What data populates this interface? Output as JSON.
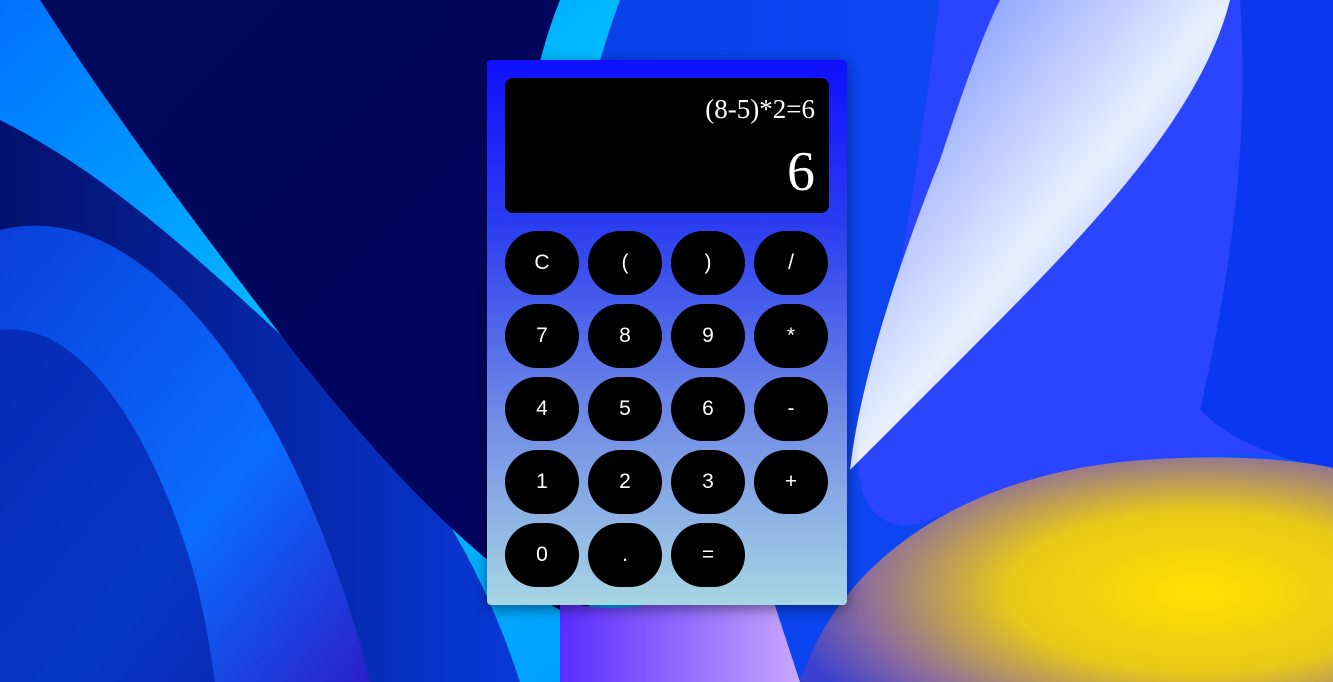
{
  "display": {
    "expression": "(8-5)*2=6",
    "result": "6"
  },
  "keypad": {
    "rows": [
      [
        {
          "label": "C",
          "name": "clear-button"
        },
        {
          "label": "(",
          "name": "open-paren-button"
        },
        {
          "label": ")",
          "name": "close-paren-button"
        },
        {
          "label": "/",
          "name": "divide-button"
        }
      ],
      [
        {
          "label": "7",
          "name": "digit-7-button"
        },
        {
          "label": "8",
          "name": "digit-8-button"
        },
        {
          "label": "9",
          "name": "digit-9-button"
        },
        {
          "label": "*",
          "name": "multiply-button"
        }
      ],
      [
        {
          "label": "4",
          "name": "digit-4-button"
        },
        {
          "label": "5",
          "name": "digit-5-button"
        },
        {
          "label": "6",
          "name": "digit-6-button"
        },
        {
          "label": "-",
          "name": "subtract-button"
        }
      ],
      [
        {
          "label": "1",
          "name": "digit-1-button"
        },
        {
          "label": "2",
          "name": "digit-2-button"
        },
        {
          "label": "3",
          "name": "digit-3-button"
        },
        {
          "label": "+",
          "name": "add-button"
        }
      ],
      [
        {
          "label": "0",
          "name": "digit-0-button"
        },
        {
          "label": ".",
          "name": "decimal-button"
        },
        {
          "label": "=",
          "name": "equals-button"
        }
      ]
    ]
  },
  "colors": {
    "calculator_top": "#0f10ff",
    "calculator_bottom": "#a7d6e4",
    "key_background": "#000000",
    "key_text": "#ffffff",
    "wallpaper_base": "#0a1fd0",
    "wallpaper_yellow": "#f5d80a"
  }
}
